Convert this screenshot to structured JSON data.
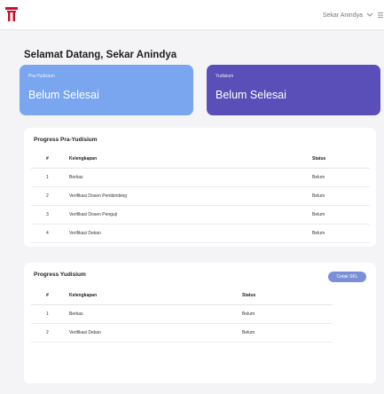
{
  "header": {
    "user_name": "Sekar Anindya",
    "logo_icon": "university-logo-icon",
    "dropdown_icon": "chevron-down-icon",
    "menu_icon": "menu-icon",
    "brand_color": "#c8102e"
  },
  "welcome": "Selamat Datang, Sekar Anindya",
  "status_cards": {
    "pre": {
      "caption": "Pra-Yudisium",
      "value": "Belum Selesai",
      "color": "#7aa6f0"
    },
    "yud": {
      "caption": "Yudisium",
      "value": "Belum Selesai",
      "color": "#5a4fb8"
    }
  },
  "pre_progress": {
    "title": "Progress Pra-Yudisium",
    "columns": [
      "#",
      "Kelengkapan",
      "Status"
    ],
    "rows": [
      [
        "1",
        "Berkas",
        "Belum"
      ],
      [
        "2",
        "Verifikasi Dosen Pembimbing",
        "Belum"
      ],
      [
        "3",
        "Verifikasi Dosen Penguji",
        "Belum"
      ],
      [
        "4",
        "Verifikasi Dekan",
        "Belum"
      ]
    ]
  },
  "yud_progress": {
    "title": "Progress Yudisium",
    "button_label": "Cetak SKL",
    "columns": [
      "#",
      "Kelengkapan",
      "Status"
    ],
    "rows": [
      [
        "1",
        "Berkas",
        "Belum"
      ],
      [
        "2",
        "Verifikasi Dekan",
        "Belum"
      ]
    ]
  }
}
